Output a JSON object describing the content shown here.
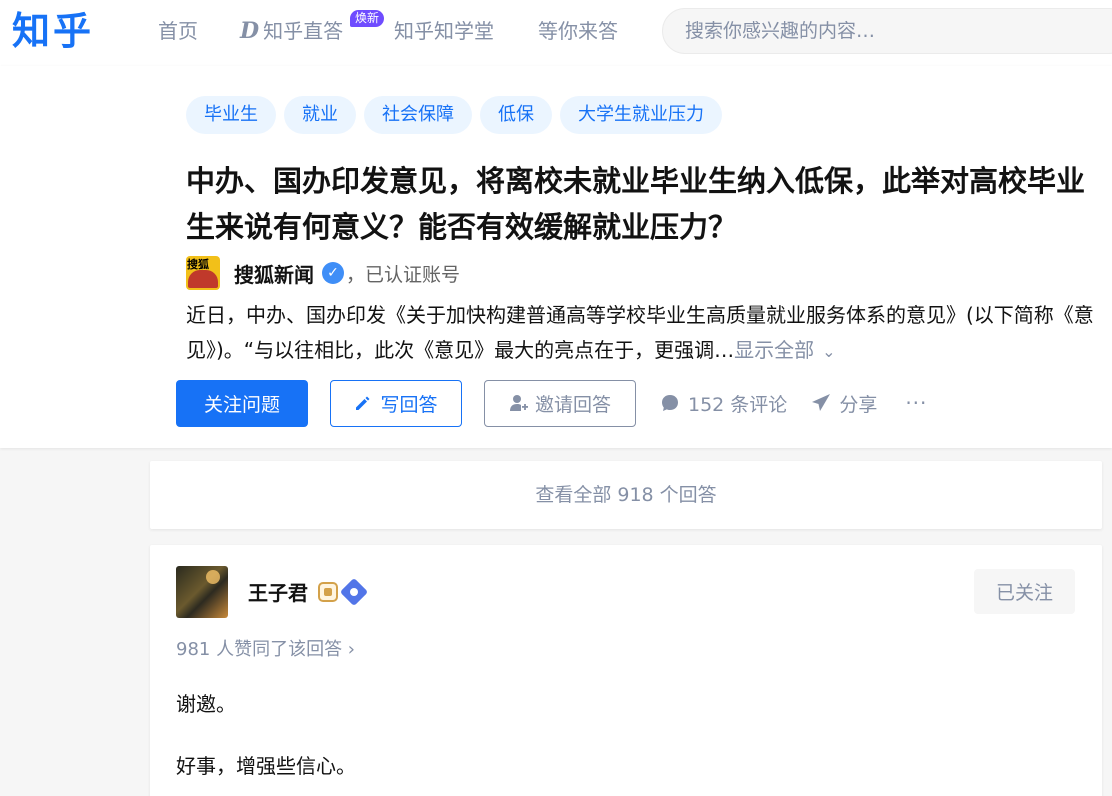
{
  "header": {
    "logo": "知乎",
    "nav": {
      "home": "首页",
      "direct": "知乎直答",
      "direct_badge": "焕新",
      "school": "知乎知学堂",
      "wait": "等你来答"
    },
    "search_placeholder": "搜索你感兴趣的内容…"
  },
  "question": {
    "topics": [
      "毕业生",
      "就业",
      "社会保障",
      "低保",
      "大学生就业压力"
    ],
    "title": "中办、国办印发意见，将离校未就业毕业生纳入低保，此举对高校毕业生来说有何意义？能否有效缓解就业压力？",
    "author": {
      "logo_text": "搜狐",
      "name": "搜狐新闻",
      "desc": "，已认证账号"
    },
    "excerpt": "近日，中办、国办印发《关于加快构建普通高等学校毕业生高质量就业服务体系的意见》(以下简称《意见》)。“与以往相比，此次《意见》最大的亮点在于，更强调…",
    "show_all": "显示全部",
    "actions": {
      "follow": "关注问题",
      "write": "写回答",
      "invite": "邀请回答",
      "comments": "152 条评论",
      "share": "分享",
      "more": "···"
    }
  },
  "view_all": "查看全部 918 个回答",
  "answer": {
    "author_name": "王子君",
    "followed": "已关注",
    "votes": "981 人赞同了该回答 ›",
    "paragraphs": [
      "谢邀。",
      "好事，增强些信心。"
    ]
  },
  "colors": {
    "brand": "#1772f6",
    "muted": "#8590a6",
    "topic_bg": "#ebf5ff"
  }
}
